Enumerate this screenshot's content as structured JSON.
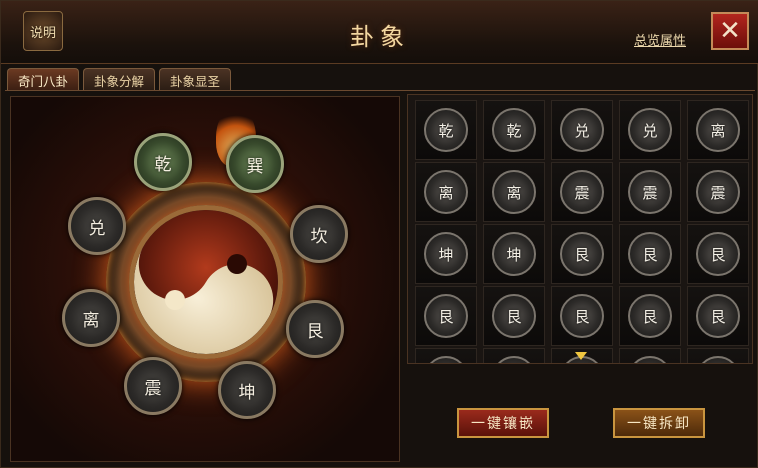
{
  "header": {
    "help_label": "说明",
    "title": "卦象",
    "overview_link": "总览属性",
    "close_label": "✕"
  },
  "tabs": [
    {
      "label": "奇门八卦",
      "active": true
    },
    {
      "label": "卦象分解",
      "active": false
    },
    {
      "label": "卦象显圣",
      "active": false
    }
  ],
  "bagua": {
    "slots": [
      {
        "label": "乾",
        "highlighted": true
      },
      {
        "label": "巽",
        "highlighted": true
      },
      {
        "label": "坎",
        "highlighted": false
      },
      {
        "label": "艮",
        "highlighted": false
      },
      {
        "label": "坤",
        "highlighted": false
      },
      {
        "label": "震",
        "highlighted": false
      },
      {
        "label": "离",
        "highlighted": false
      },
      {
        "label": "兑",
        "highlighted": false
      }
    ]
  },
  "inventory": {
    "rows": [
      [
        "乾",
        "乾",
        "兑",
        "兑",
        "离"
      ],
      [
        "离",
        "离",
        "震",
        "震",
        "震"
      ],
      [
        "坤",
        "坤",
        "艮",
        "艮",
        "艮"
      ],
      [
        "艮",
        "艮",
        "艮",
        "艮",
        "艮"
      ],
      [
        "",
        "",
        "",
        "",
        ""
      ]
    ]
  },
  "actions": {
    "inlay_all": "一键镶嵌",
    "remove_all": "一键拆卸"
  },
  "colors": {
    "accent_red": "#9a2a1c",
    "accent_gold": "#c9953f",
    "title_text": "#f3d7a0"
  }
}
